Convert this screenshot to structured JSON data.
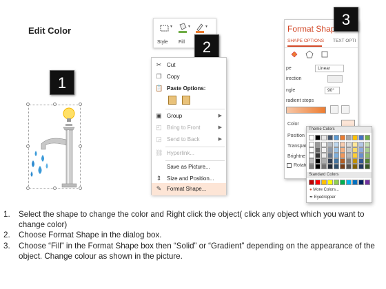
{
  "title": "Edit Color",
  "badges": [
    "1",
    "2",
    "3"
  ],
  "ribbon": {
    "style_label": "Style",
    "fill_label": "Fill",
    "outline_label": "O"
  },
  "context_menu": {
    "items": [
      {
        "label": "Cut",
        "icon": "scissors-icon",
        "enabled": true
      },
      {
        "label": "Copy",
        "icon": "copy-icon",
        "enabled": true
      },
      {
        "label": "Paste Options:",
        "icon": "paste-icon",
        "enabled": true
      },
      {
        "label": "Group",
        "icon": "group-icon",
        "enabled": true,
        "submenu": true
      },
      {
        "label": "Bring to Front",
        "icon": "bring-front-icon",
        "enabled": false,
        "submenu": true
      },
      {
        "label": "Send to Back",
        "icon": "send-back-icon",
        "enabled": false,
        "submenu": true
      },
      {
        "label": "Hyperlink...",
        "icon": "link-icon",
        "enabled": false
      },
      {
        "label": "Save as Picture...",
        "icon": "",
        "enabled": true
      },
      {
        "label": "Size and Position...",
        "icon": "size-icon",
        "enabled": true
      },
      {
        "label": "Format Shape...",
        "icon": "format-shape-icon",
        "enabled": true,
        "highlighted": true
      }
    ]
  },
  "format_shape": {
    "title": "Format Shape",
    "tab_shape_options": "SHAPE OPTIONS",
    "tab_text_options": "TEXT OPTI",
    "rows": {
      "type_label": "pe",
      "type_value": "Linear",
      "direction_label": "irection",
      "angle_label": "ngle",
      "angle_value": "90°",
      "gradient_stops_label": "radient stops",
      "color_label": "Color",
      "position_label": "Position",
      "transparency_label": "Transpar",
      "brightness_label": "Brightne",
      "rotate_label": "Rotate"
    },
    "palette": {
      "theme_colors_label": "Theme Colors",
      "standard_colors_label": "Standard Colors",
      "more_colors_label": "More Colors...",
      "eyedropper_label": "Eyedropper",
      "theme_top": [
        "#ffffff",
        "#000000",
        "#e7e6e6",
        "#44546a",
        "#5b9bd5",
        "#ed7d31",
        "#a5a5a5",
        "#ffc000",
        "#4472c4",
        "#70ad47"
      ],
      "standard": [
        "#c00000",
        "#ff0000",
        "#ffc000",
        "#ffff00",
        "#92d050",
        "#00b050",
        "#00b0f0",
        "#0070c0",
        "#002060",
        "#7030a0"
      ]
    }
  },
  "instructions": [
    {
      "num": "1.",
      "text": "Select the shape to change the color and Right click the object( click any object which you want to change color)"
    },
    {
      "num": "2.",
      "text": "Choose Format Shape in the dialog box."
    },
    {
      "num": "3.",
      "text": "Choose “Fill” in the Format Shape box then “Solid” or “Gradient” depending on the appearance of the object. Change colour as shown in the picture."
    }
  ]
}
